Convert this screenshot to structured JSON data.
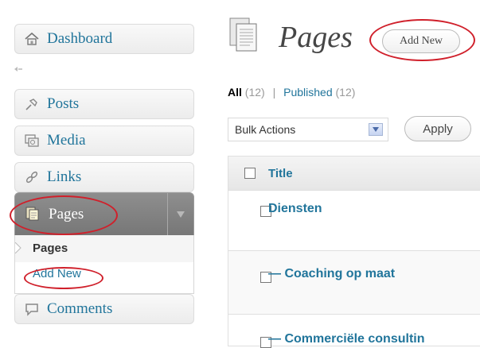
{
  "sidebar": {
    "items": [
      {
        "label": "Dashboard",
        "icon": "home-icon"
      },
      {
        "label": "Posts",
        "icon": "pin-icon"
      },
      {
        "label": "Media",
        "icon": "media-icon"
      },
      {
        "label": "Links",
        "icon": "link-icon"
      },
      {
        "label": "Pages",
        "icon": "pages-icon"
      },
      {
        "label": "Comments",
        "icon": "comments-icon"
      }
    ],
    "submenu": {
      "current": "Pages",
      "add_new": "Add New"
    }
  },
  "header": {
    "title": "Pages",
    "add_new": "Add New"
  },
  "filters": {
    "all": "All",
    "all_count": "(12)",
    "separator": "|",
    "published": "Published",
    "published_count": "(12)"
  },
  "bulk": {
    "selected": "Bulk Actions",
    "apply": "Apply"
  },
  "table": {
    "header_title": "Title",
    "rows": [
      {
        "title": "Diensten"
      },
      {
        "title": "— Coaching op maat"
      },
      {
        "title": "— Commerciële consultin"
      }
    ]
  },
  "colors": {
    "link": "#21759b",
    "annotation": "#d0202b",
    "active_menu": "#7f7f7f"
  }
}
